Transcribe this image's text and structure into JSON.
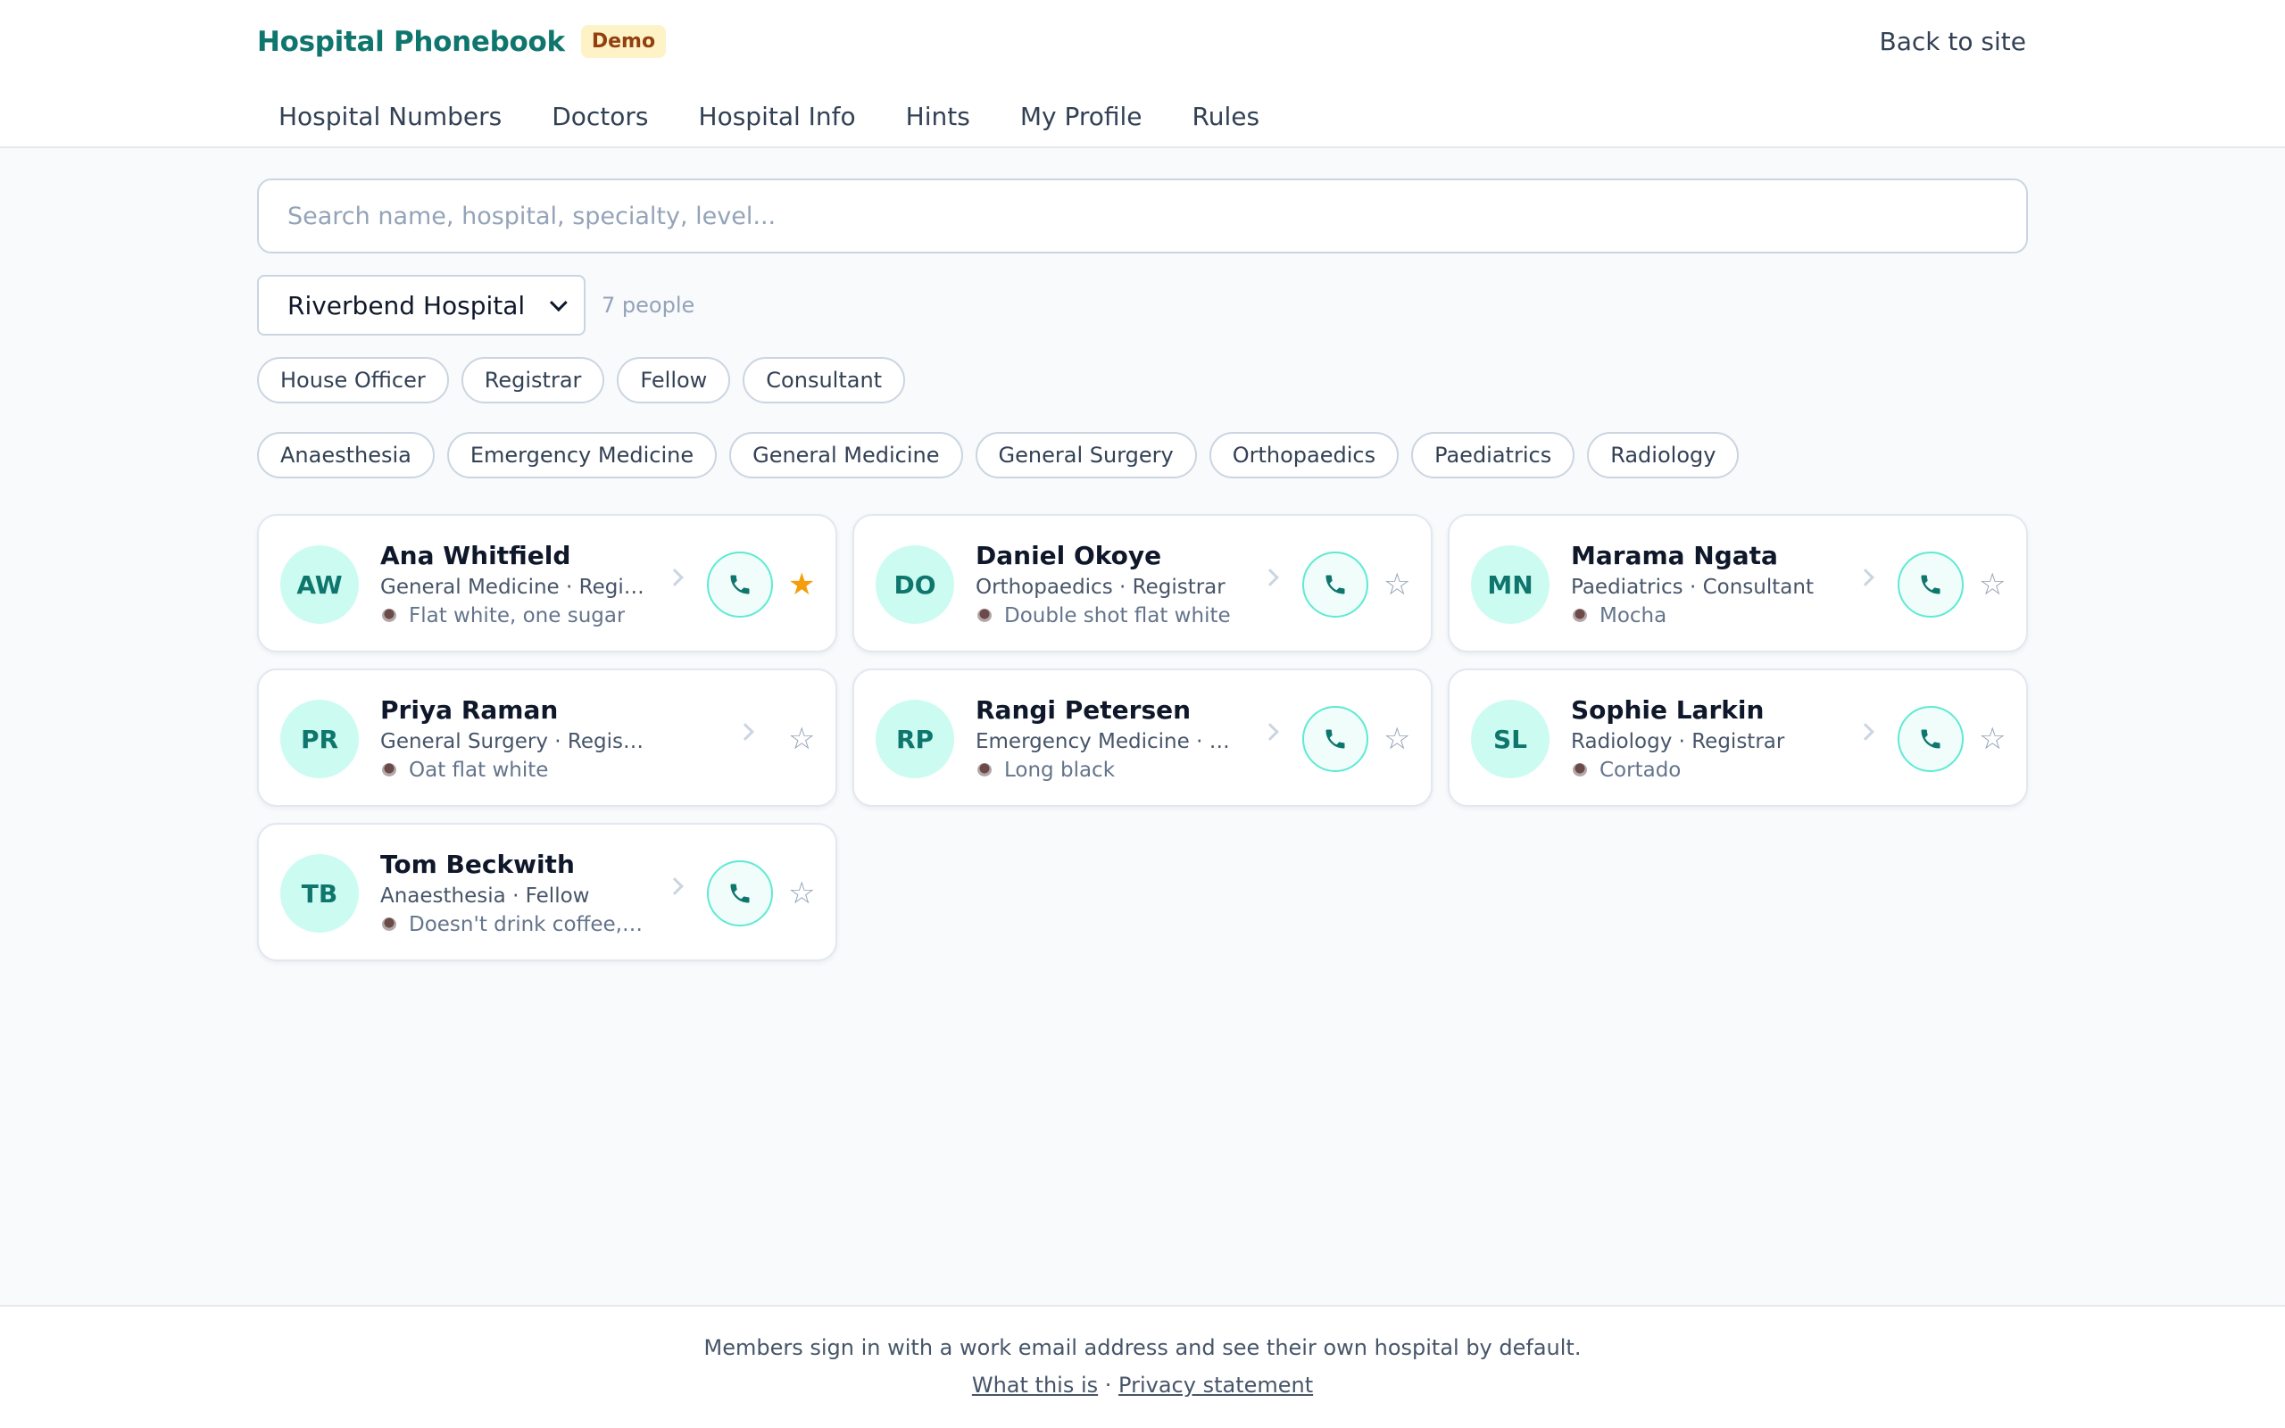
{
  "header": {
    "title": "Hospital Phonebook",
    "badge": "Demo",
    "back_link": "Back to site",
    "nav": [
      "Hospital Numbers",
      "Doctors",
      "Hospital Info",
      "Hints",
      "My Profile",
      "Rules"
    ]
  },
  "search": {
    "placeholder": "Search name, hospital, specialty, level..."
  },
  "filters": {
    "hospital": "Riverbend Hospital",
    "count": "7 people",
    "levels": [
      "House Officer",
      "Registrar",
      "Fellow",
      "Consultant"
    ],
    "specialties": [
      "Anaesthesia",
      "Emergency Medicine",
      "General Medicine",
      "General Surgery",
      "Orthopaedics",
      "Paediatrics",
      "Radiology"
    ]
  },
  "people": [
    {
      "initials": "AW",
      "name": "Ana Whitfield",
      "meta": "General Medicine · Regist...",
      "coffee": "Flat white, one sugar",
      "starred": true,
      "has_phone": true
    },
    {
      "initials": "DO",
      "name": "Daniel Okoye",
      "meta": "Orthopaedics · Registrar",
      "coffee": "Double shot flat white",
      "starred": false,
      "has_phone": true
    },
    {
      "initials": "MN",
      "name": "Marama Ngata",
      "meta": "Paediatrics · Consultant",
      "coffee": "Mocha",
      "starred": false,
      "has_phone": true
    },
    {
      "initials": "PR",
      "name": "Priya Raman",
      "meta": "General Surgery · Registrar",
      "coffee": "Oat flat white",
      "starred": false,
      "has_phone": false
    },
    {
      "initials": "RP",
      "name": "Rangi Petersen",
      "meta": "Emergency Medicine · Ho...",
      "coffee": "Long black",
      "starred": false,
      "has_phone": true
    },
    {
      "initials": "SL",
      "name": "Sophie Larkin",
      "meta": "Radiology · Registrar",
      "coffee": "Cortado",
      "starred": false,
      "has_phone": true
    },
    {
      "initials": "TB",
      "name": "Tom Beckwith",
      "meta": "Anaesthesia · Fellow",
      "coffee": "Doesn't drink coffee, ...",
      "starred": false,
      "has_phone": true
    }
  ],
  "footer": {
    "note": "Members sign in with a work email address and see their own hospital by default.",
    "link_about": "What this is",
    "separator": "·",
    "link_privacy": "Privacy statement"
  },
  "colors": {
    "accent": "#0f766e",
    "star_active": "#f59e0b",
    "star_inactive": "#94a3b8",
    "avatar_bg": "#ccfbf1"
  }
}
